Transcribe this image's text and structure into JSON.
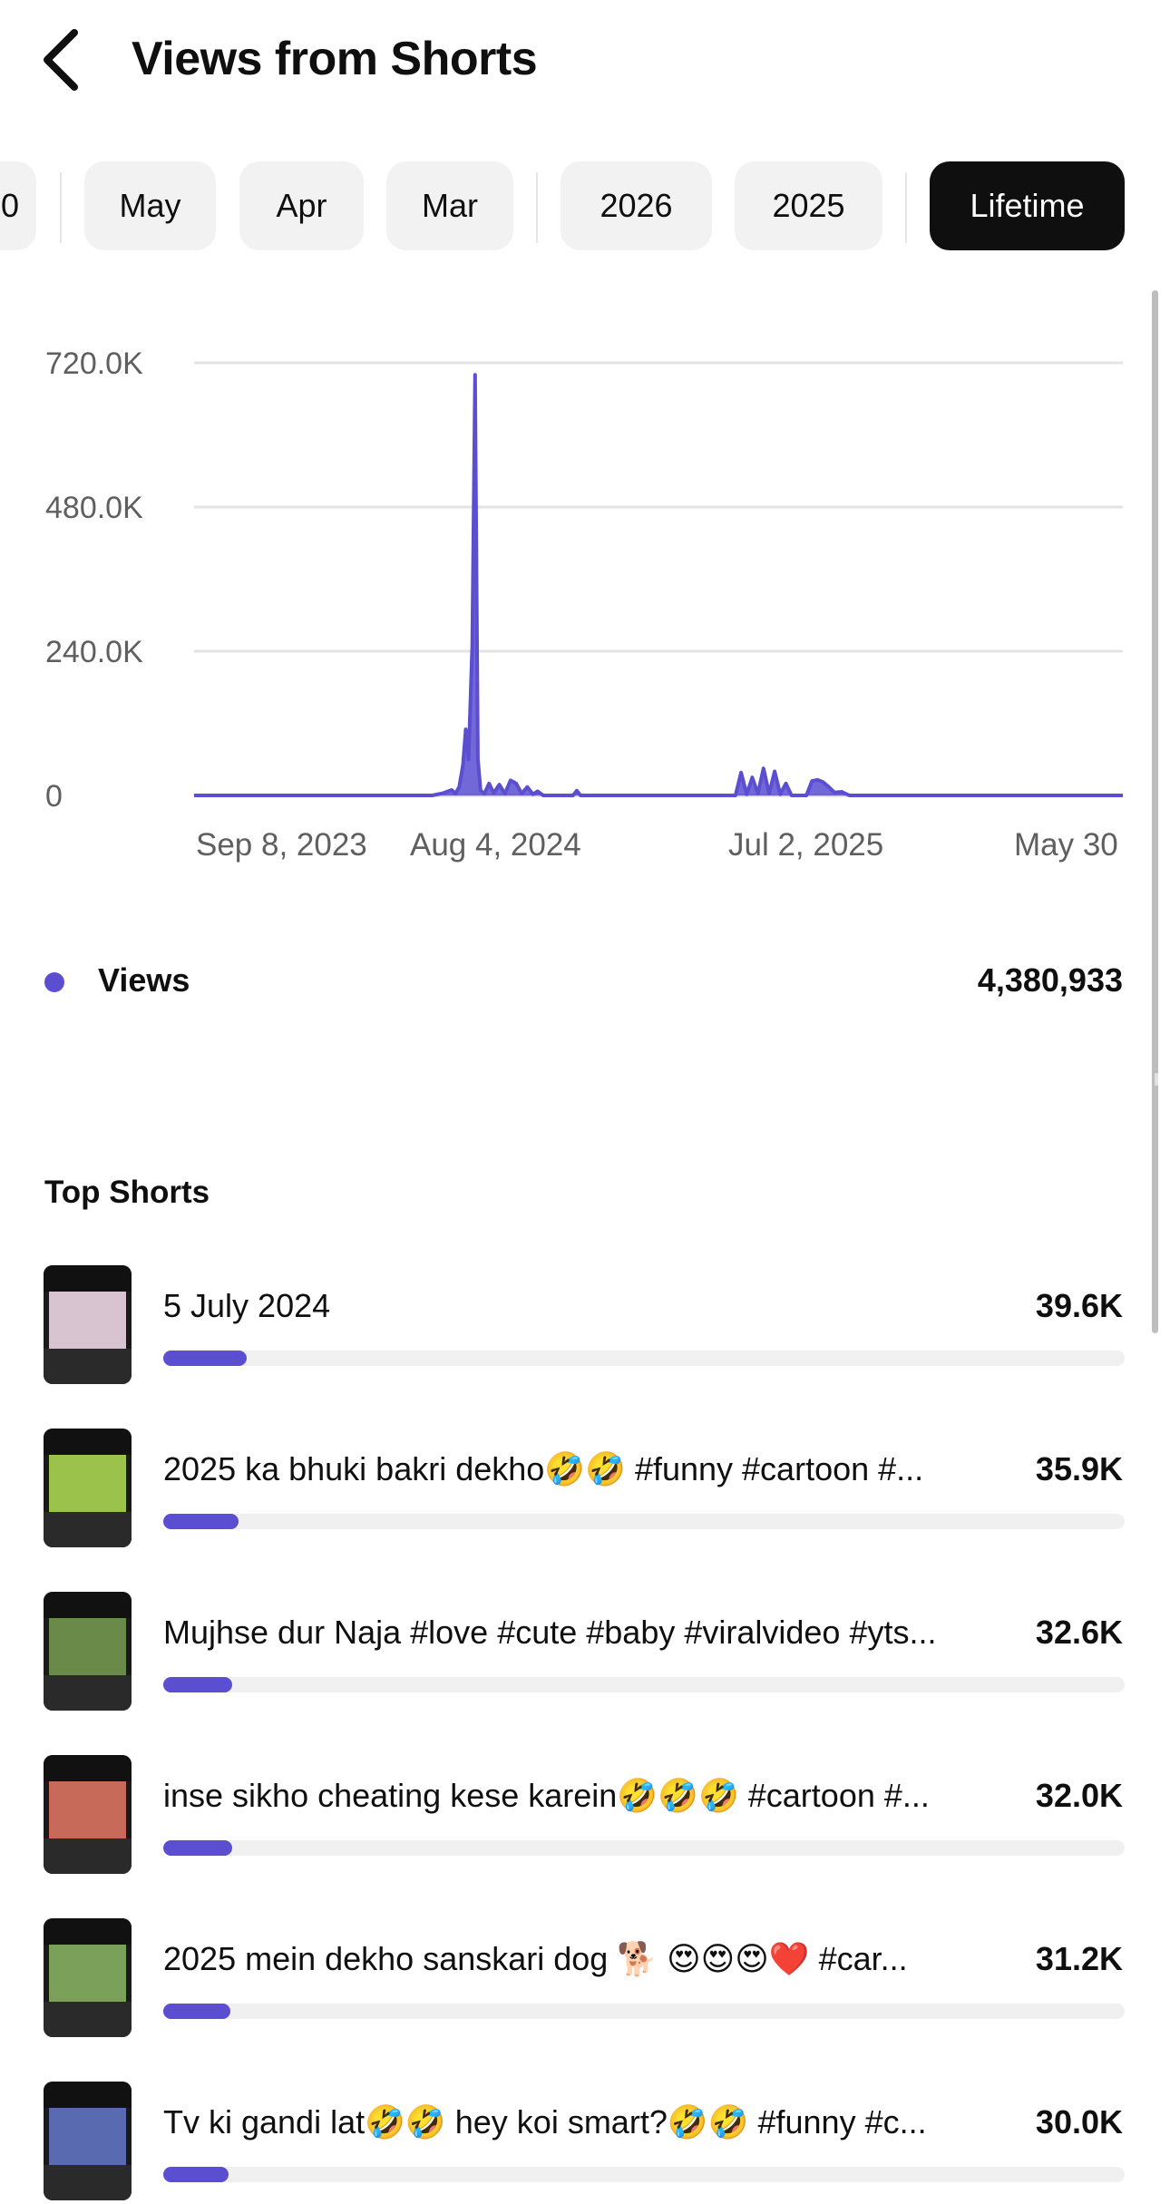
{
  "header": {
    "title": "Views from Shorts",
    "back_icon": "chevron-left-icon"
  },
  "filters": {
    "partial_chip": "0",
    "months": [
      "May",
      "Apr",
      "Mar"
    ],
    "years": [
      "2026",
      "2025"
    ],
    "active": "Lifetime"
  },
  "chart_data": {
    "type": "line",
    "title": "",
    "xlabel": "",
    "ylabel": "",
    "color": "#5b4ed1",
    "y_ticks": [
      "720.0K",
      "480.0K",
      "240.0K",
      "0"
    ],
    "ylim": [
      0,
      720000
    ],
    "x_ticks": [
      "Sep 8, 2023",
      "Aug 4, 2024",
      "Jul 2, 2025",
      "May 30"
    ],
    "series": [
      {
        "values_note_free": true,
        "points": [
          [
            "Sep 8, 2023",
            0
          ],
          [
            "May 20, 2024",
            0
          ],
          [
            "Jun 1, 2024",
            4000
          ],
          [
            "Jun 10, 2024",
            9000
          ],
          [
            "Jun 14, 2024",
            3000
          ],
          [
            "Jun 18, 2024",
            14000
          ],
          [
            "Jun 22, 2024",
            50000
          ],
          [
            "Jun 25, 2024",
            110000
          ],
          [
            "Jun 28, 2024",
            60000
          ],
          [
            "Jul 2, 2024",
            250000
          ],
          [
            "Jul 5, 2024",
            700000
          ],
          [
            "Jul 8, 2024",
            60000
          ],
          [
            "Jul 11, 2024",
            8000
          ],
          [
            "Jul 15, 2024",
            3000
          ],
          [
            "Jul 20, 2024",
            20000
          ],
          [
            "Jul 25, 2024",
            4000
          ],
          [
            "Jul 31, 2024",
            18000
          ],
          [
            "Aug 6, 2024",
            3000
          ],
          [
            "Aug 12, 2024",
            25000
          ],
          [
            "Aug 18, 2024",
            20000
          ],
          [
            "Aug 24, 2024",
            3000
          ],
          [
            "Aug 30, 2024",
            14000
          ],
          [
            "Sep 5, 2024",
            2000
          ],
          [
            "Sep 10, 2024",
            7000
          ],
          [
            "Sep 16, 2024",
            0
          ],
          [
            "Oct 18, 2024",
            0
          ],
          [
            "Oct 22, 2024",
            8000
          ],
          [
            "Oct 26, 2024",
            0
          ],
          [
            "Apr 10, 2025",
            0
          ],
          [
            "Apr 16, 2025",
            38000
          ],
          [
            "Apr 22, 2025",
            2000
          ],
          [
            "Apr 28, 2025",
            30000
          ],
          [
            "May 4, 2025",
            3000
          ],
          [
            "May 10, 2025",
            45000
          ],
          [
            "May 16, 2025",
            3000
          ],
          [
            "May 22, 2025",
            40000
          ],
          [
            "May 28, 2025",
            2000
          ],
          [
            "Jun 3, 2025",
            20000
          ],
          [
            "Jun 9, 2025",
            0
          ],
          [
            "Jun 25, 2025",
            0
          ],
          [
            "Jul 1, 2025",
            24000
          ],
          [
            "Jul 7, 2025",
            26000
          ],
          [
            "Jul 13, 2025",
            22000
          ],
          [
            "Jul 19, 2025",
            14000
          ],
          [
            "Jul 25, 2025",
            5000
          ],
          [
            "Aug 2, 2025",
            6000
          ],
          [
            "Aug 10, 2025",
            0
          ],
          [
            "May 30, 2026",
            0
          ]
        ]
      }
    ]
  },
  "legend": {
    "label": "Views",
    "total": "4,380,933",
    "dot_color": "#5b4ed1"
  },
  "top_shorts": {
    "title": "Top Shorts",
    "items": [
      {
        "title": "5 July 2024",
        "views": "39.6K",
        "fraction": 0.087,
        "thumb": "#d8c4d0"
      },
      {
        "title": "2025 ka bhuki bakri dekho🤣🤣 #funny #cartoon #...",
        "views": "35.9K",
        "fraction": 0.078,
        "thumb": "#9bc24a"
      },
      {
        "title": "Mujhse dur Naja #love #cute #baby #viralvideo #yts...",
        "views": "32.6K",
        "fraction": 0.072,
        "thumb": "#6a8a4a"
      },
      {
        "title": "inse sikho cheating kese karein🤣🤣🤣 #cartoon #...",
        "views": "32.0K",
        "fraction": 0.072,
        "thumb": "#c86a5a"
      },
      {
        "title": "2025 mein dekho sanskari dog 🐕 😍😍😍❤️ #car...",
        "views": "31.2K",
        "fraction": 0.07,
        "thumb": "#7aa05a"
      },
      {
        "title": "Tv ki gandi lat🤣🤣 hey koi smart?🤣🤣 #funny #c...",
        "views": "30.0K",
        "fraction": 0.068,
        "thumb": "#5a6ab0"
      }
    ]
  }
}
